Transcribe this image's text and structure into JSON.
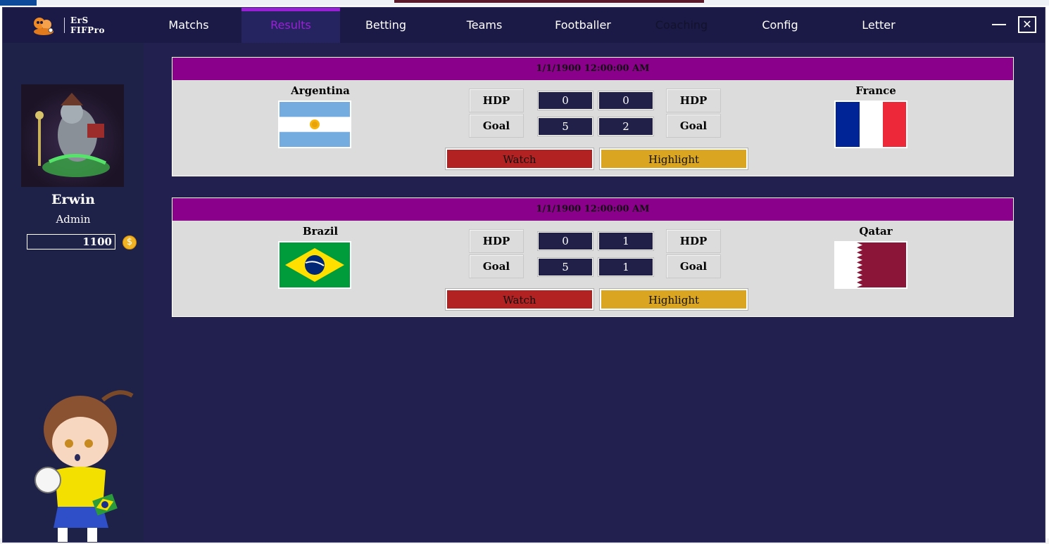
{
  "app": {
    "logo_line1": "ErS",
    "logo_line2": "FIFPro"
  },
  "nav": {
    "tabs": [
      {
        "label": "Matchs"
      },
      {
        "label": "Results"
      },
      {
        "label": "Betting"
      },
      {
        "label": "Teams"
      },
      {
        "label": "Footballer"
      },
      {
        "label": "Coaching"
      },
      {
        "label": "Config"
      },
      {
        "label": "Letter"
      }
    ],
    "active": "Results",
    "minimize": "—",
    "close": "✕"
  },
  "user": {
    "name": "Erwin",
    "role": "Admin",
    "balance": "1100",
    "coin_symbol": "$"
  },
  "matches": [
    {
      "datetime": "1/1/1900 12:00:00 AM",
      "home_team": "Argentina",
      "away_team": "France",
      "home_flag": "argentina-flag",
      "away_flag": "france-flag",
      "hdp_label": "HDP",
      "goal_label": "Goal",
      "home_hdp": "0",
      "away_hdp": "0",
      "home_goal": "5",
      "away_goal": "2",
      "watch_label": "Watch",
      "highlight_label": "Highlight"
    },
    {
      "datetime": "1/1/1900 12:00:00 AM",
      "home_team": "Brazil",
      "away_team": "Qatar",
      "home_flag": "brazil-flag",
      "away_flag": "qatar-flag",
      "hdp_label": "HDP",
      "goal_label": "Goal",
      "home_hdp": "0",
      "away_hdp": "1",
      "home_goal": "5",
      "away_goal": "1",
      "watch_label": "Watch",
      "highlight_label": "Highlight"
    }
  ],
  "colors": {
    "window_bg": "#22204f",
    "navbar_bg": "#1b1a46",
    "active_tab": "#9b1fd6",
    "card_header": "#8b008b",
    "watch_button": "#b22222",
    "highlight_button": "#daa520"
  }
}
